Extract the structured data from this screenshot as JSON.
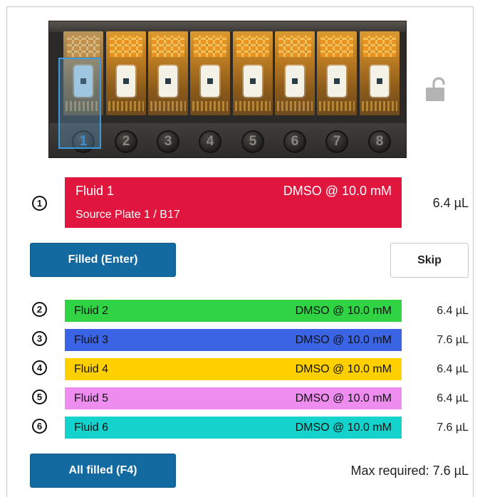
{
  "cartridge": {
    "wells": [
      "1",
      "2",
      "3",
      "4",
      "5",
      "6",
      "7",
      "8"
    ],
    "selected_well": "1",
    "lock_icon": "unlocked-padlock-icon"
  },
  "current": {
    "index": "①",
    "name": "Fluid 1",
    "concentration": "DMSO @ 10.0 mM",
    "source": "Source Plate 1 / B17",
    "volume": "6.4 µL",
    "color": "#e0163e"
  },
  "buttons": {
    "filled": "Filled  (Enter)",
    "skip": "Skip",
    "all_filled": "All filled  (F4)"
  },
  "queue": [
    {
      "index": "②",
      "name": "Fluid 2",
      "concentration": "DMSO @ 10.0 mM",
      "volume": "6.4 µL",
      "color": "#30d343"
    },
    {
      "index": "③",
      "name": "Fluid 3",
      "concentration": "DMSO @ 10.0 mM",
      "volume": "7.6 µL",
      "color": "#3a64e3"
    },
    {
      "index": "④",
      "name": "Fluid 4",
      "concentration": "DMSO @ 10.0 mM",
      "volume": "6.4 µL",
      "color": "#ffd000"
    },
    {
      "index": "⑤",
      "name": "Fluid 5",
      "concentration": "DMSO @ 10.0 mM",
      "volume": "6.4 µL",
      "color": "#ee8cf0"
    },
    {
      "index": "⑥",
      "name": "Fluid 6",
      "concentration": "DMSO @ 10.0 mM",
      "volume": "7.6 µL",
      "color": "#14d3cc"
    }
  ],
  "footer": {
    "max_required": "Max required: 7.6 µL"
  }
}
